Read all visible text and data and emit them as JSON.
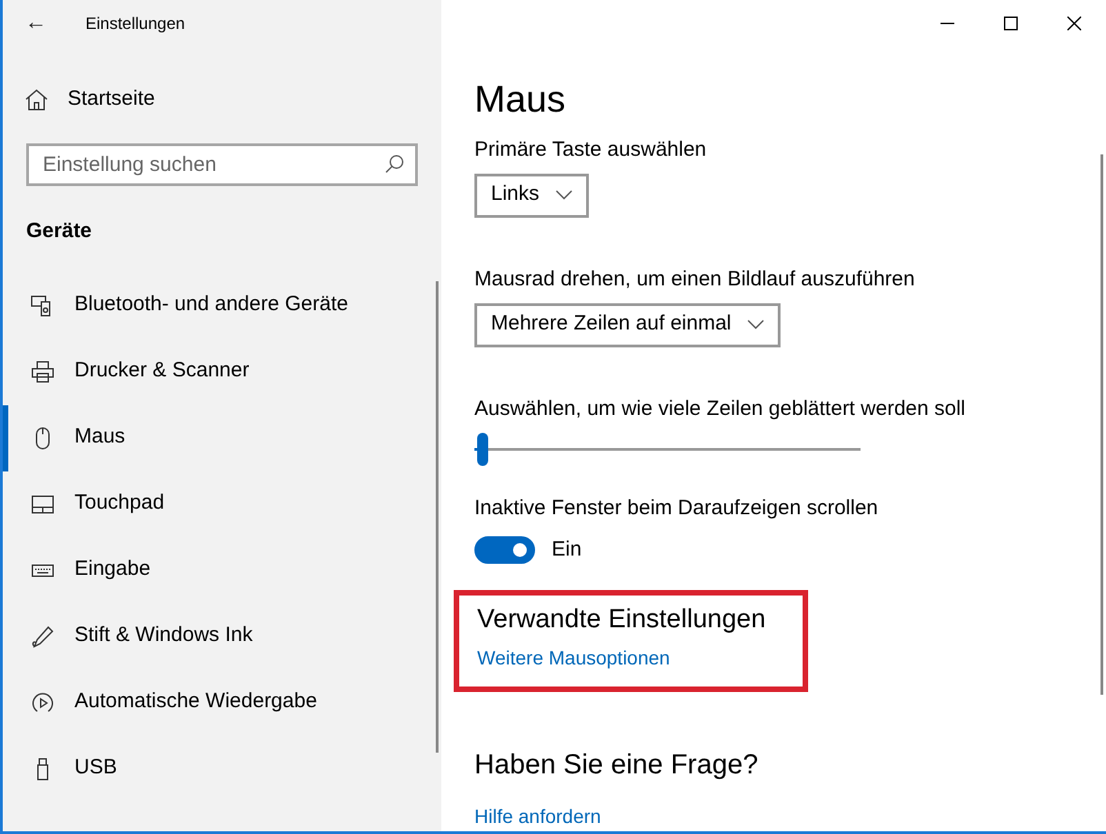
{
  "window": {
    "title": "Einstellungen",
    "back": "←"
  },
  "sidebar": {
    "home": "Startseite",
    "search": {
      "placeholder": "Einstellung suchen"
    },
    "section": "Geräte",
    "items": [
      {
        "label": "Bluetooth- und andere Geräte",
        "selected": false
      },
      {
        "label": "Drucker & Scanner",
        "selected": false
      },
      {
        "label": "Maus",
        "selected": true
      },
      {
        "label": "Touchpad",
        "selected": false
      },
      {
        "label": "Eingabe",
        "selected": false
      },
      {
        "label": "Stift & Windows Ink",
        "selected": false
      },
      {
        "label": "Automatische Wiedergabe",
        "selected": false
      },
      {
        "label": "USB",
        "selected": false
      }
    ]
  },
  "main": {
    "title": "Maus",
    "settings": [
      {
        "kind": "dropdown",
        "label": "Primäre Taste auswählen",
        "value": "Links"
      },
      {
        "kind": "dropdown",
        "label": "Mausrad drehen, um einen Bildlauf auszuführen",
        "value": "Mehrere Zeilen auf einmal"
      },
      {
        "kind": "slider",
        "label": "Auswählen, um wie viele Zeilen geblättert werden soll",
        "level": 0.02
      },
      {
        "kind": "toggle",
        "label": "Inaktive Fenster beim Daraufzeigen scrollen",
        "on": true,
        "state_text": "Ein"
      }
    ],
    "related": {
      "title": "Verwandte Einstellungen",
      "link": "Weitere Mausoptionen",
      "highlighted": true
    },
    "help": {
      "title": "Haben Sie eine Frage?",
      "link": "Hilfe anfordern"
    }
  }
}
